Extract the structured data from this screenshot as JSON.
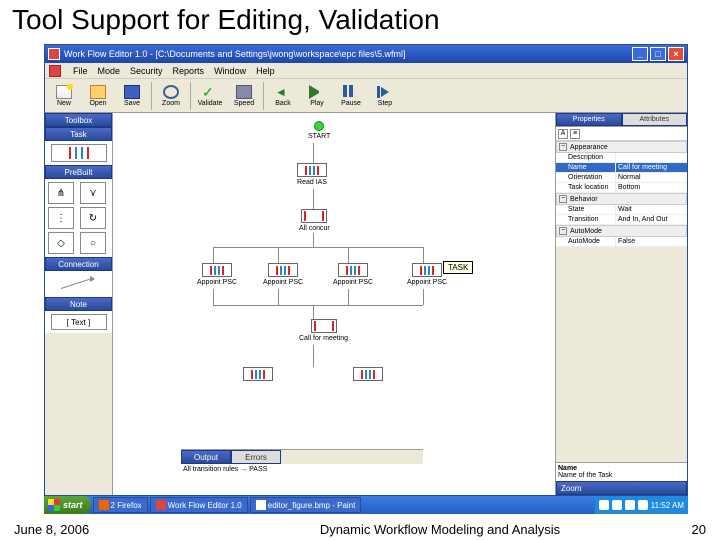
{
  "slide": {
    "title": "Tool Support for Editing, Validation",
    "footer_left": "June 8, 2006",
    "footer_center": "Dynamic Workflow Modeling and Analysis",
    "footer_right": "20"
  },
  "window": {
    "title": "Work Flow Editor 1.0 - [C:\\Documents and Settings\\jwong\\workspace\\epc files\\5.wfml]"
  },
  "menu": [
    "File",
    "Mode",
    "Security",
    "Reports",
    "Window",
    "Help"
  ],
  "toolbar": {
    "new": "New",
    "open": "Open",
    "save": "Save",
    "zoom": "Zoom",
    "validate": "Validate",
    "speed": "Speed",
    "back": "Back",
    "play": "Play",
    "pause": "Pause",
    "step": "Step"
  },
  "left": {
    "toolbox": "Toolbox",
    "task": "Task",
    "prebuilt": "PreBuilt",
    "connection": "Connection",
    "note": "Note",
    "note_text": "[ Text ]"
  },
  "canvas": {
    "start": "START",
    "read_ias": "Read IAS",
    "all_concur": "All concur",
    "appoint_psc1": "Appoint PSC",
    "appoint_psc2": "Appoint PSC",
    "appoint_psc3": "Appoint PSC",
    "appoint_psc4": "Appoint PSC",
    "call_meeting": "Call for meeting",
    "tooltip": "TASK"
  },
  "right": {
    "tab_props": "Properties",
    "tab_attrs": "Attributes",
    "cat_appearance": "Appearance",
    "cat_behavior": "Behavior",
    "cat_automode": "AutoMode",
    "rows": {
      "description_k": "Description",
      "description_v": "",
      "name_k": "Name",
      "name_v": "Call for meeting",
      "orientation_k": "Orientation",
      "orientation_v": "Normal",
      "tasklocation_k": "Task location",
      "tasklocation_v": "Bottom",
      "state_k": "State",
      "state_v": "Wait",
      "transition_k": "Transition",
      "transition_v": "And In, And Out",
      "automode_k": "AutoMode",
      "automode_v": "False"
    },
    "desc_name": "Name",
    "desc_text": "Name of the Task",
    "zoom": "Zoom"
  },
  "bottom": {
    "tab_output": "Output",
    "tab_errors": "Errors",
    "body": "All transition rules → PASS"
  },
  "taskbar": {
    "start": "start",
    "items": [
      "2 Firefox",
      "Work Flow Editor 1.0",
      "editor_figure.bmp - Paint"
    ],
    "clock": "11:52 AM"
  }
}
